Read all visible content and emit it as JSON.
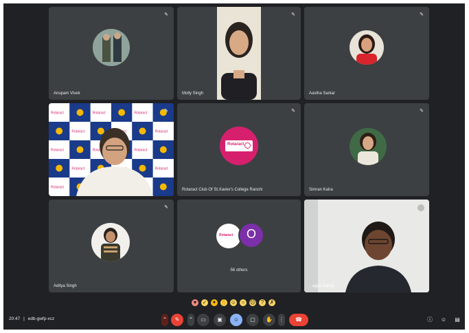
{
  "meeting": {
    "time": "20:47",
    "code": "edb-gwfp-xcz",
    "others_label": "56 others",
    "others_count_letter": "O"
  },
  "participants": [
    {
      "name": "Anupam Vivek"
    },
    {
      "name": "Molly Singh"
    },
    {
      "name": "Aastha Sarkar"
    },
    {
      "name": ""
    },
    {
      "name": "Rotaract Club Of St.Xavier's College Ranchi"
    },
    {
      "name": "Simran Kalra"
    },
    {
      "name": "Aditya Singh"
    },
    {
      "name": ""
    },
    {
      "name": "...agya Sahay"
    }
  ],
  "banner_text": "Rotaract",
  "colors": {
    "background": "#202124",
    "tile": "#3c4043",
    "end_call": "#ea4335",
    "others_avatar": "#8e24aa",
    "rotaract_pink": "#d6206e"
  },
  "icons": {
    "mic": "mic-off-icon",
    "hand": "raise-hand-icon",
    "end": "end-call-icon"
  }
}
